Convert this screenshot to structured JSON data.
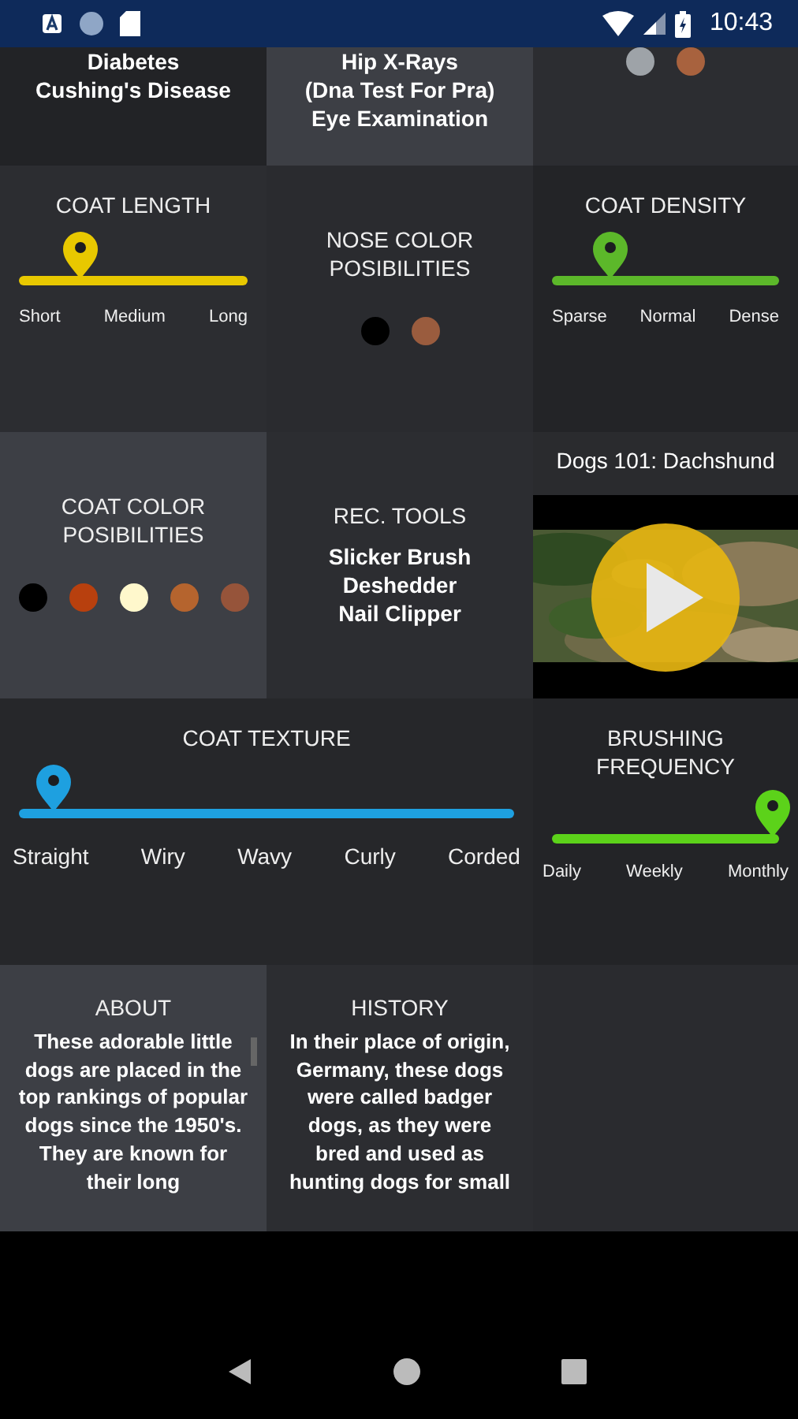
{
  "status_bar": {
    "time": "10:43"
  },
  "tiles": [
    {
      "kind": "text_list",
      "lines": [
        "Diabetes",
        "Cushing's Disease"
      ]
    },
    {
      "kind": "text_list",
      "lines": [
        "Hip X-Rays",
        "(Dna Test For Pra)",
        "Eye Examination"
      ]
    },
    {
      "kind": "dots",
      "dots": [
        {
          "color": "#9ea3a8"
        },
        {
          "color": "#a8623e"
        }
      ]
    },
    {
      "kind": "slider",
      "title": "COAT LENGTH",
      "color": "#e8c800",
      "level": 0.27,
      "labels": [
        "Short",
        "Medium",
        "Long"
      ]
    },
    {
      "kind": "dots",
      "title": "NOSE COLOR POSIBILITIES",
      "dots": [
        {
          "color": "#000000"
        },
        {
          "color": "#9a5c3e"
        }
      ]
    },
    {
      "kind": "slider",
      "title": "COAT DENSITY",
      "color": "#5cb82a",
      "level": 0.26,
      "labels": [
        "Sparse",
        "Normal",
        "Dense"
      ]
    },
    {
      "kind": "dots",
      "title": "COAT COLOR POSIBILITIES",
      "dots": [
        {
          "color": "#000000"
        },
        {
          "color": "#b8400e"
        },
        {
          "color": "#fff8cc"
        },
        {
          "color": "#b5642e"
        },
        {
          "color": "#96543a"
        }
      ]
    },
    {
      "kind": "text_list",
      "title": "REC. TOOLS",
      "lines": [
        "Slicker Brush",
        "Deshedder",
        "Nail Clipper"
      ]
    },
    {
      "kind": "video",
      "title": "Dogs 101: Dachshund"
    },
    {
      "kind": "slider",
      "wide": true,
      "title": "COAT TEXTURE",
      "color": "#1ea0e0",
      "level": 0.07,
      "labels": [
        "Straight",
        "Wiry",
        "Wavy",
        "Curly",
        "Corded"
      ]
    },
    {
      "kind": "slider",
      "title": "BRUSHING FREQUENCY",
      "color": "#5cd21a",
      "level": 0.97,
      "labels": [
        "Daily",
        "Weekly",
        "Monthly"
      ]
    },
    {
      "kind": "paragraph",
      "title": "ABOUT",
      "text": "These adorable little dogs are placed in the top rankings of popular dogs since the 1950's. They are known for their long"
    },
    {
      "kind": "paragraph",
      "title": "HISTORY",
      "text": "In their place of origin, Germany, these dogs were called badger dogs, as they were bred and used as hunting dogs for small"
    },
    {
      "kind": "empty"
    }
  ]
}
